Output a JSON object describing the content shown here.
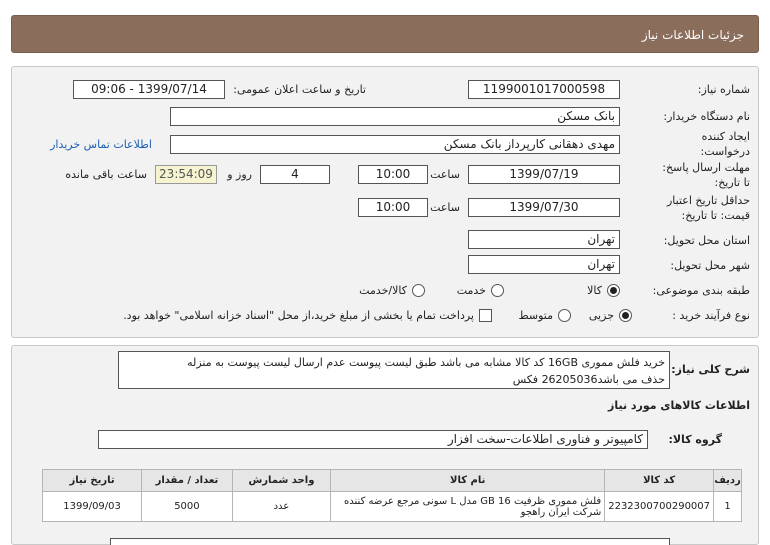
{
  "header": {
    "title": "جزئیات اطلاعات نیاز"
  },
  "form": {
    "need_number_label": "شماره نیاز:",
    "need_number": "1199001017000598",
    "announce_label": "تاریخ و ساعت اعلان عمومی:",
    "announce_value": "1399/07/14 - 09:06",
    "buyer_label": "نام دستگاه خریدار:",
    "buyer_value": "بانک مسکن",
    "creator_label_1": "ایجاد کننده",
    "creator_label_2": "درخواست:",
    "creator_value": "مهدی دهقانی کارپرداز بانک مسکن",
    "contact_link": "اطلاعات تماس خریدار",
    "reply_deadline_label_1": "مهلت ارسال پاسخ:",
    "reply_deadline_label_2": "تا تاریخ:",
    "reply_date": "1399/07/19",
    "time_label": "ساعت",
    "reply_time": "10:00",
    "days_value": "4",
    "day_label": "روز و",
    "remaining_value": "23:54:09",
    "remaining_label": "ساعت باقی مانده",
    "price_validity_label_1": "حداقل تاریخ اعتبار",
    "price_validity_label_2": "قیمت: تا تاریخ:",
    "price_date": "1399/07/30",
    "price_time": "10:00",
    "province_label": "استان محل تحویل:",
    "province_value": "تهران",
    "city_label": "شهر محل تحویل:",
    "city_value": "تهران",
    "category_label": "طبقه بندی موضوعی:",
    "category_options": [
      "کالا",
      "خدمت",
      "کالا/خدمت"
    ],
    "process_label": "نوع فرآیند خرید :",
    "process_options": [
      "جزیی",
      "متوسط"
    ],
    "payment_note": "پرداخت تمام یا بخشی از مبلغ خرید،از محل \"اسناد خزانه اسلامی\" خواهد بود."
  },
  "details": {
    "desc_label": "شرح کلی نیاز:",
    "desc_line1": "خرید فلش مموری 16GB کد کالا مشابه می باشد طبق لیست پیوست عدم ارسال لیست پیوست به منزله",
    "desc_line2": "حذف می باشد26205036 فکس",
    "goods_info_title": "اطلاعات کالاهای مورد نیاز",
    "group_label": "گروه کالا:",
    "group_value": "کامپیوتر و فناوری اطلاعات-سخت افزار"
  },
  "table": {
    "headers": [
      "ردیف",
      "کد کالا",
      "نام کالا",
      "واحد شمارش",
      "تعداد / مقدار",
      "تاریخ نیاز"
    ],
    "rows": [
      [
        "1",
        "2232300700290007",
        "فلش مموری ظرفیت 16 GB مدل L سونی مرجع عرضه کننده شرکت ایران راهجو",
        "عدد",
        "5000",
        "1399/09/03"
      ]
    ]
  }
}
